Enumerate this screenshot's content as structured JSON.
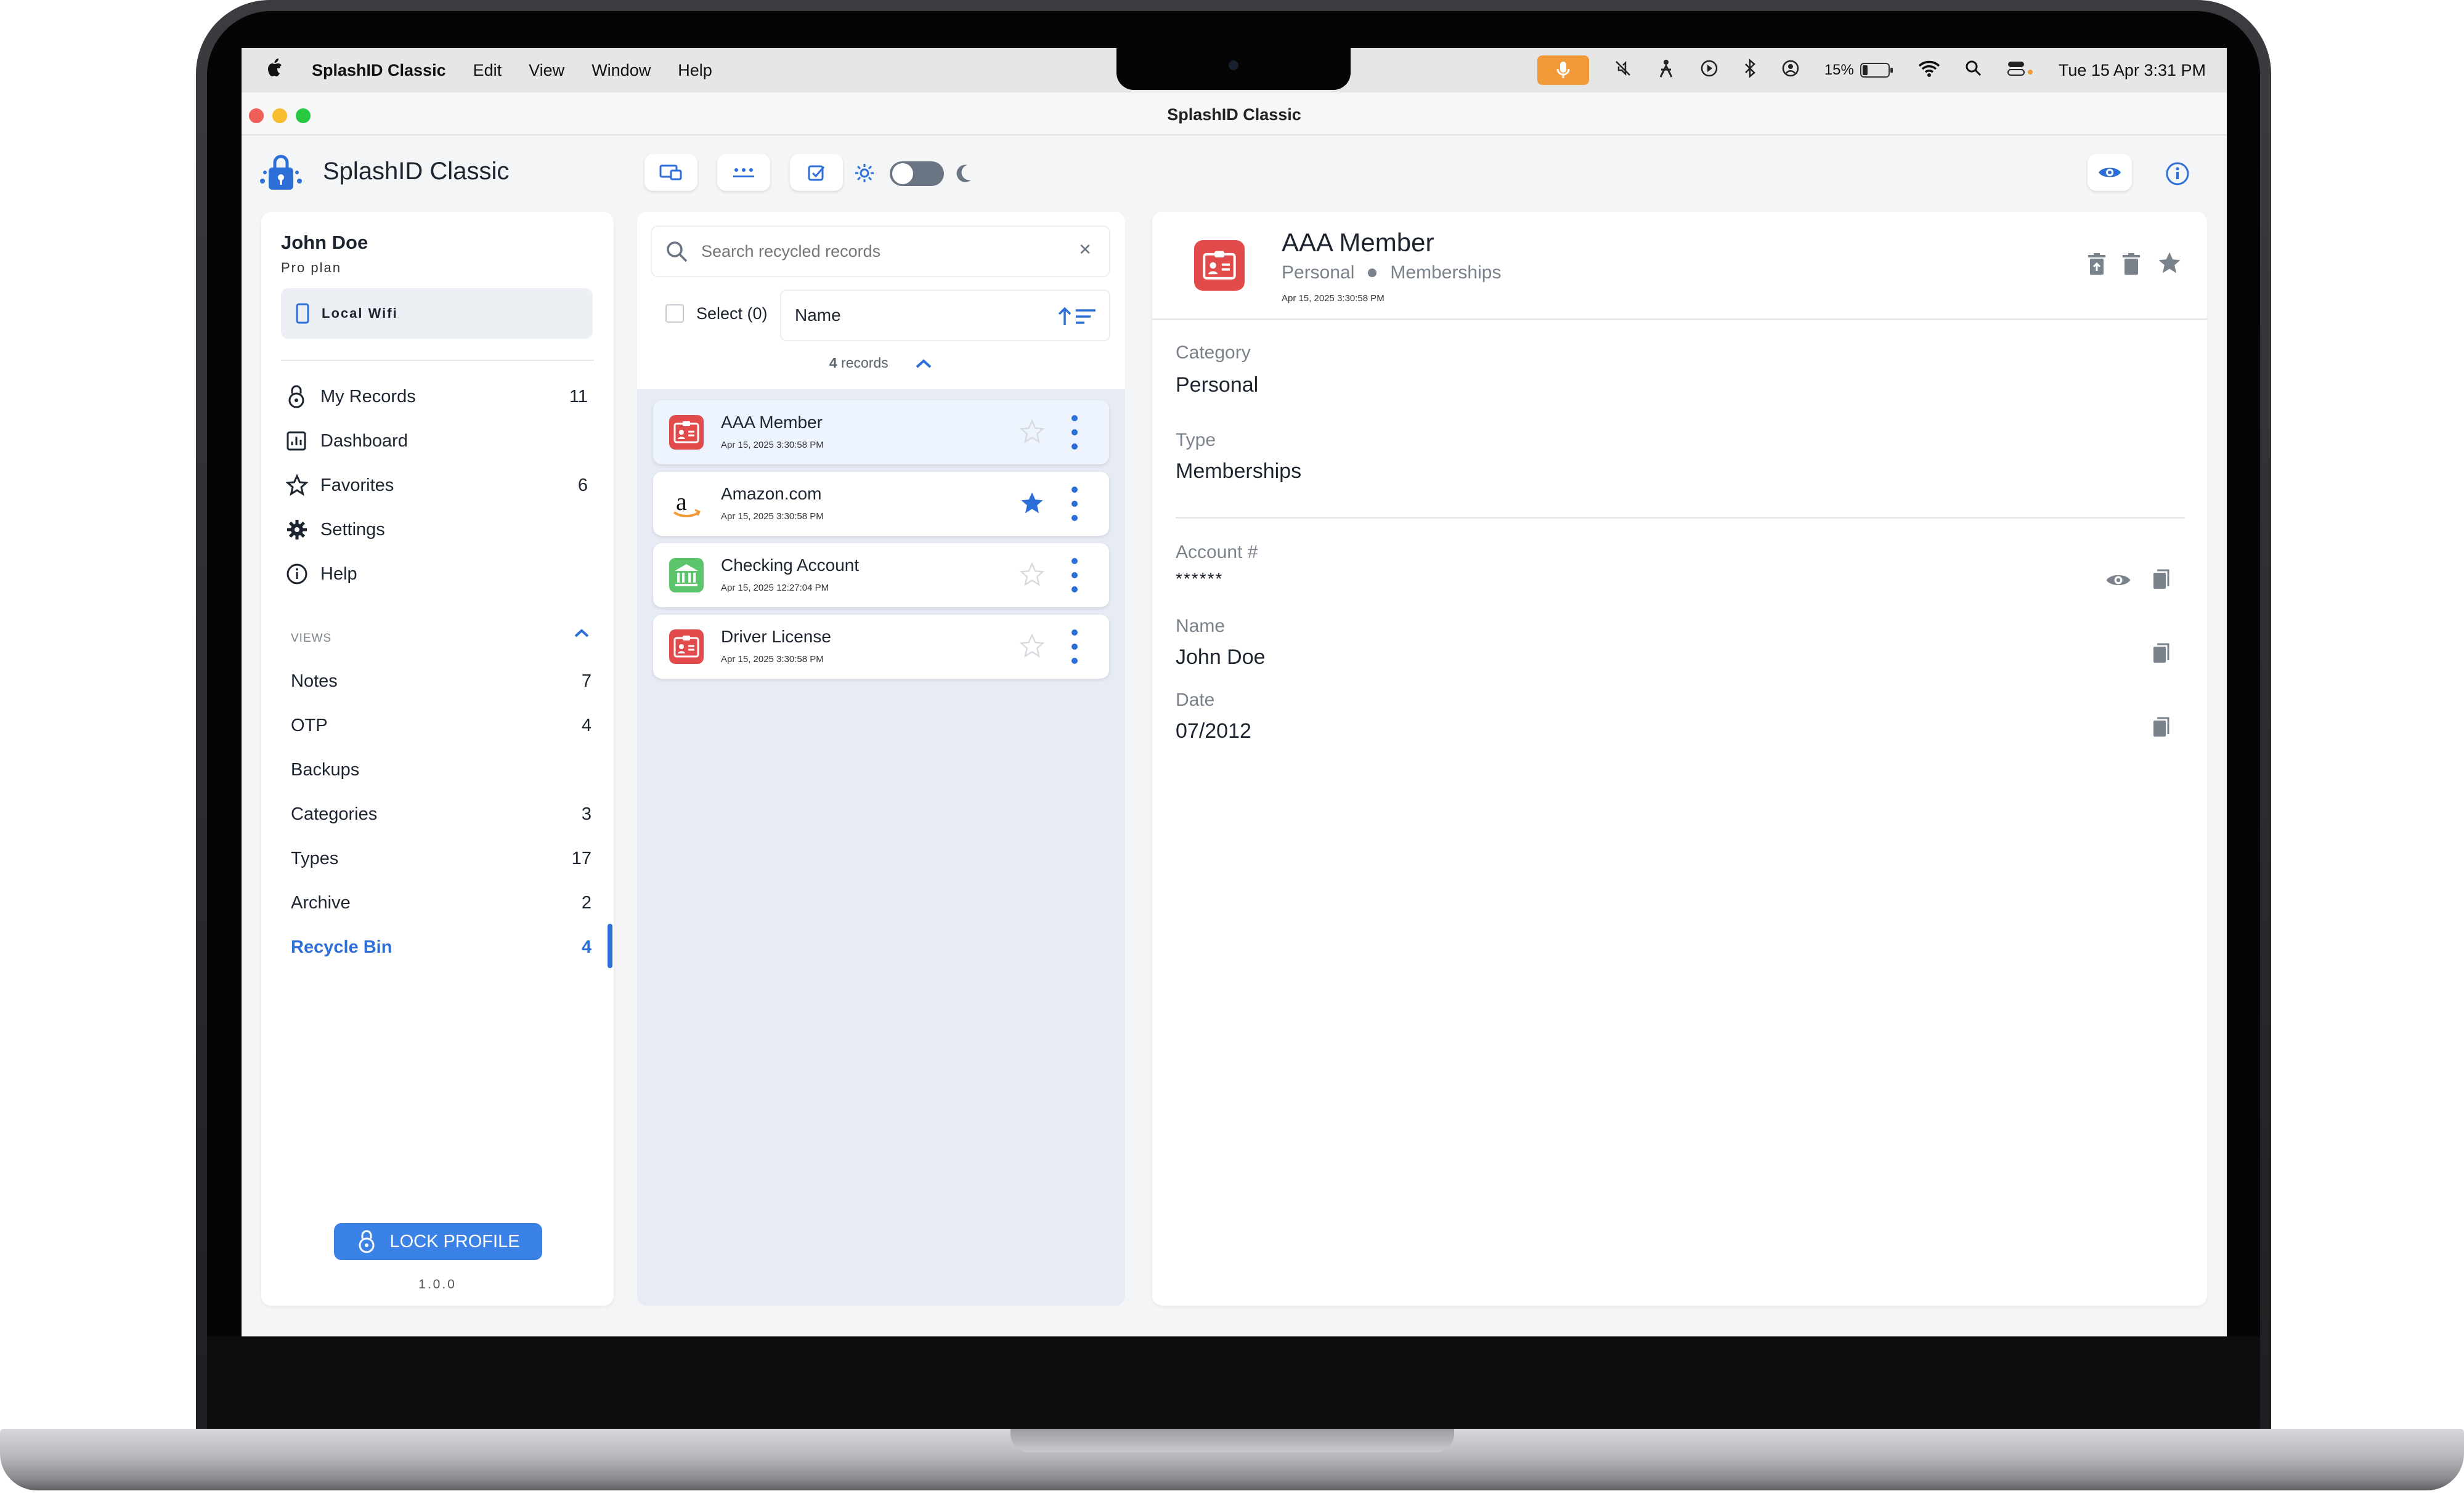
{
  "menubar": {
    "app": "SplashID Classic",
    "items": [
      "Edit",
      "View",
      "Window",
      "Help"
    ],
    "battery": "15%",
    "datetime": "Tue 15 Apr  3:31 PM"
  },
  "window": {
    "title": "SplashID Classic"
  },
  "brand": {
    "name": "SplashID Classic",
    "accent": "#2d6fd8"
  },
  "user": {
    "name": "John Doe",
    "plan": "Pro plan",
    "sync": "Local Wifi"
  },
  "nav": {
    "my_records": {
      "label": "My Records",
      "count": "11"
    },
    "dashboard": {
      "label": "Dashboard"
    },
    "favorites": {
      "label": "Favorites",
      "count": "6"
    },
    "settings": {
      "label": "Settings"
    },
    "help": {
      "label": "Help"
    }
  },
  "views": {
    "heading": "VIEWS",
    "notes": {
      "label": "Notes",
      "count": "7"
    },
    "otp": {
      "label": "OTP",
      "count": "4"
    },
    "backups": {
      "label": "Backups"
    },
    "categories": {
      "label": "Categories",
      "count": "3"
    },
    "types": {
      "label": "Types",
      "count": "17"
    },
    "archive": {
      "label": "Archive",
      "count": "2"
    },
    "recycle_bin": {
      "label": "Recycle Bin",
      "count": "4"
    }
  },
  "footer": {
    "lock_label": "LOCK PROFILE",
    "version": "1.0.0"
  },
  "list": {
    "search_placeholder": "Search recycled records",
    "select_label": "Select (0)",
    "sort_field": "Name",
    "count_number": "4",
    "count_word": "records",
    "records": [
      {
        "title": "AAA Member",
        "date": "Apr 15, 2025 3:30:58 PM",
        "icon": "id-card-icon",
        "favorite": false
      },
      {
        "title": "Amazon.com",
        "date": "Apr 15, 2025 3:30:58 PM",
        "icon": "amazon-logo-icon",
        "favorite": true
      },
      {
        "title": "Checking Account",
        "date": "Apr 15, 2025 12:27:04 PM",
        "icon": "bank-icon",
        "favorite": false
      },
      {
        "title": "Driver License",
        "date": "Apr 15, 2025 3:30:58 PM",
        "icon": "id-card-icon",
        "favorite": false
      }
    ]
  },
  "detail": {
    "title": "AAA Member",
    "category": "Personal",
    "type": "Memberships",
    "date": "Apr 15, 2025 3:30:58 PM",
    "fields": {
      "category_label": "Category",
      "category_value": "Personal",
      "type_label": "Type",
      "type_value": "Memberships",
      "account_label": "Account #",
      "account_value": "******",
      "name_label": "Name",
      "name_value": "John Doe",
      "date_label": "Date",
      "date_value": "07/2012"
    }
  }
}
